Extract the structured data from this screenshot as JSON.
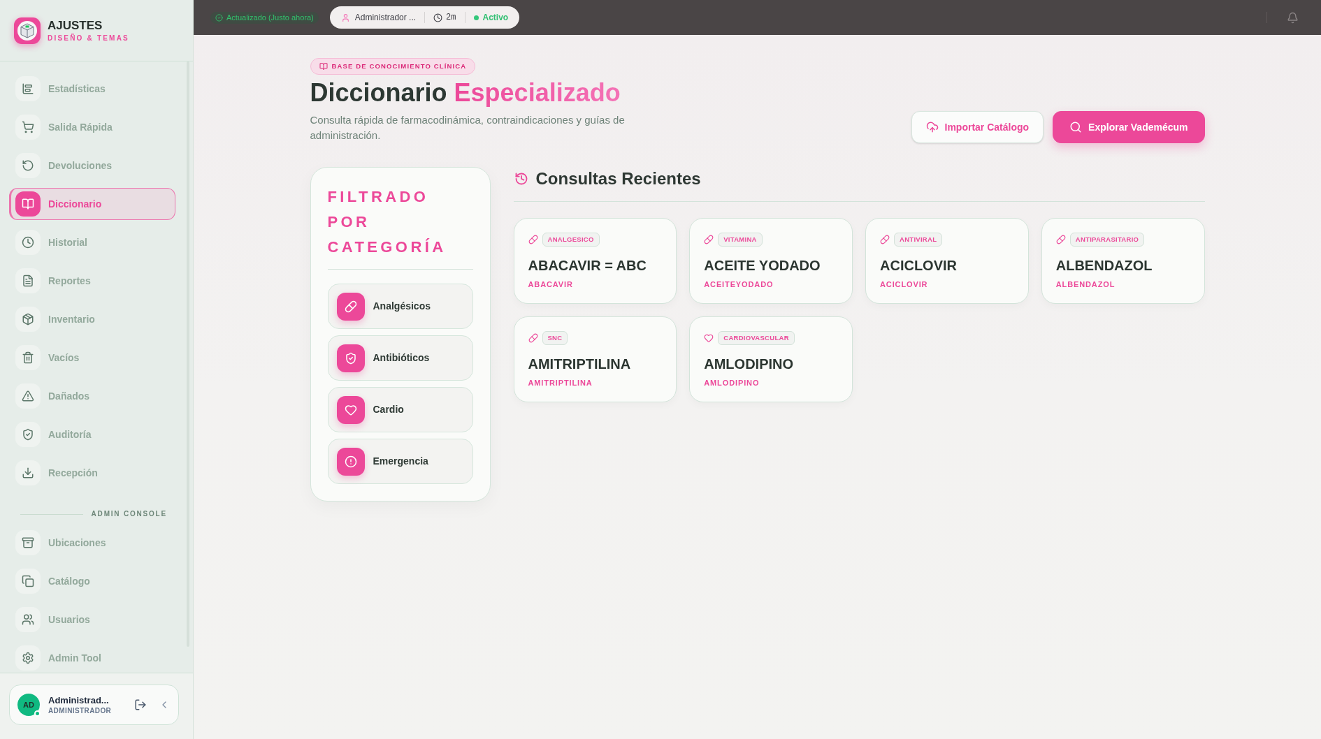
{
  "sidebar": {
    "brand": {
      "title": "AJUSTES",
      "subtitle": "DISEÑO & TEMAS"
    },
    "nav": [
      {
        "label": "Estadísticas",
        "selected": false
      },
      {
        "label": "Salida Rápida",
        "selected": false
      },
      {
        "label": "Devoluciones",
        "selected": false
      },
      {
        "label": "Diccionario",
        "selected": true
      },
      {
        "label": "Historial",
        "selected": false
      },
      {
        "label": "Reportes",
        "selected": false
      },
      {
        "label": "Inventario",
        "selected": false
      },
      {
        "label": "Vacíos",
        "selected": false
      },
      {
        "label": "Dañados",
        "selected": false
      },
      {
        "label": "Auditoría",
        "selected": false
      },
      {
        "label": "Recepción",
        "selected": false
      }
    ],
    "admin_section": {
      "label": "ADMIN CONSOLE",
      "items": [
        {
          "label": "Ubicaciones",
          "selected": false
        },
        {
          "label": "Catálogo",
          "selected": false
        },
        {
          "label": "Usuarios",
          "selected": false
        },
        {
          "label": "Admin Tool",
          "selected": false
        }
      ]
    },
    "user": {
      "initials": "AD",
      "name": "Administrad...",
      "role": "ADMINISTRADOR",
      "online": true
    }
  },
  "top_bar": {
    "sync_status": "Actualizado (Justo ahora)",
    "session": {
      "user": "Administrador ...",
      "duration": "2m",
      "status": "Activo"
    }
  },
  "header": {
    "badge": "BASE DE CONOCIMIENTO CLÍNICA",
    "title": "Diccionario",
    "title_highlight": "Especializado",
    "subtitle": "Consulta rápida de farmacodinámica, contraindicaciones y guías de administración.",
    "actions": [
      {
        "label": "Importar Catálogo",
        "kind": "secondary"
      },
      {
        "label": "Explorar Vademécum",
        "kind": "primary"
      }
    ]
  },
  "filter": {
    "title": "FILTRADO POR CATEGORÍA",
    "categories": [
      "Analgésicos",
      "Antibióticos",
      "Cardio",
      "Emergencia"
    ]
  },
  "recent": {
    "title": "Consultas Recientes",
    "items": [
      {
        "category": "ANALGESICO",
        "name": "ABACAVIR = ABC",
        "generic": "ABACAVIR"
      },
      {
        "category": "VITAMINA",
        "name": "ACEITE YODADO",
        "generic": "ACEITEYODADO"
      },
      {
        "category": "ANTIVIRAL",
        "name": "ACICLOVIR",
        "generic": "ACICLOVIR"
      },
      {
        "category": "ANTIPARASITARIO",
        "name": "ALBENDAZOL",
        "generic": "ALBENDAZOL"
      },
      {
        "category": "SNC",
        "name": "AMITRIPTILINA",
        "generic": "AMITRIPTILINA"
      },
      {
        "category": "CARDIOVASCULAR",
        "name": "AMLODIPINO",
        "generic": "AMLODIPINO"
      }
    ]
  }
}
